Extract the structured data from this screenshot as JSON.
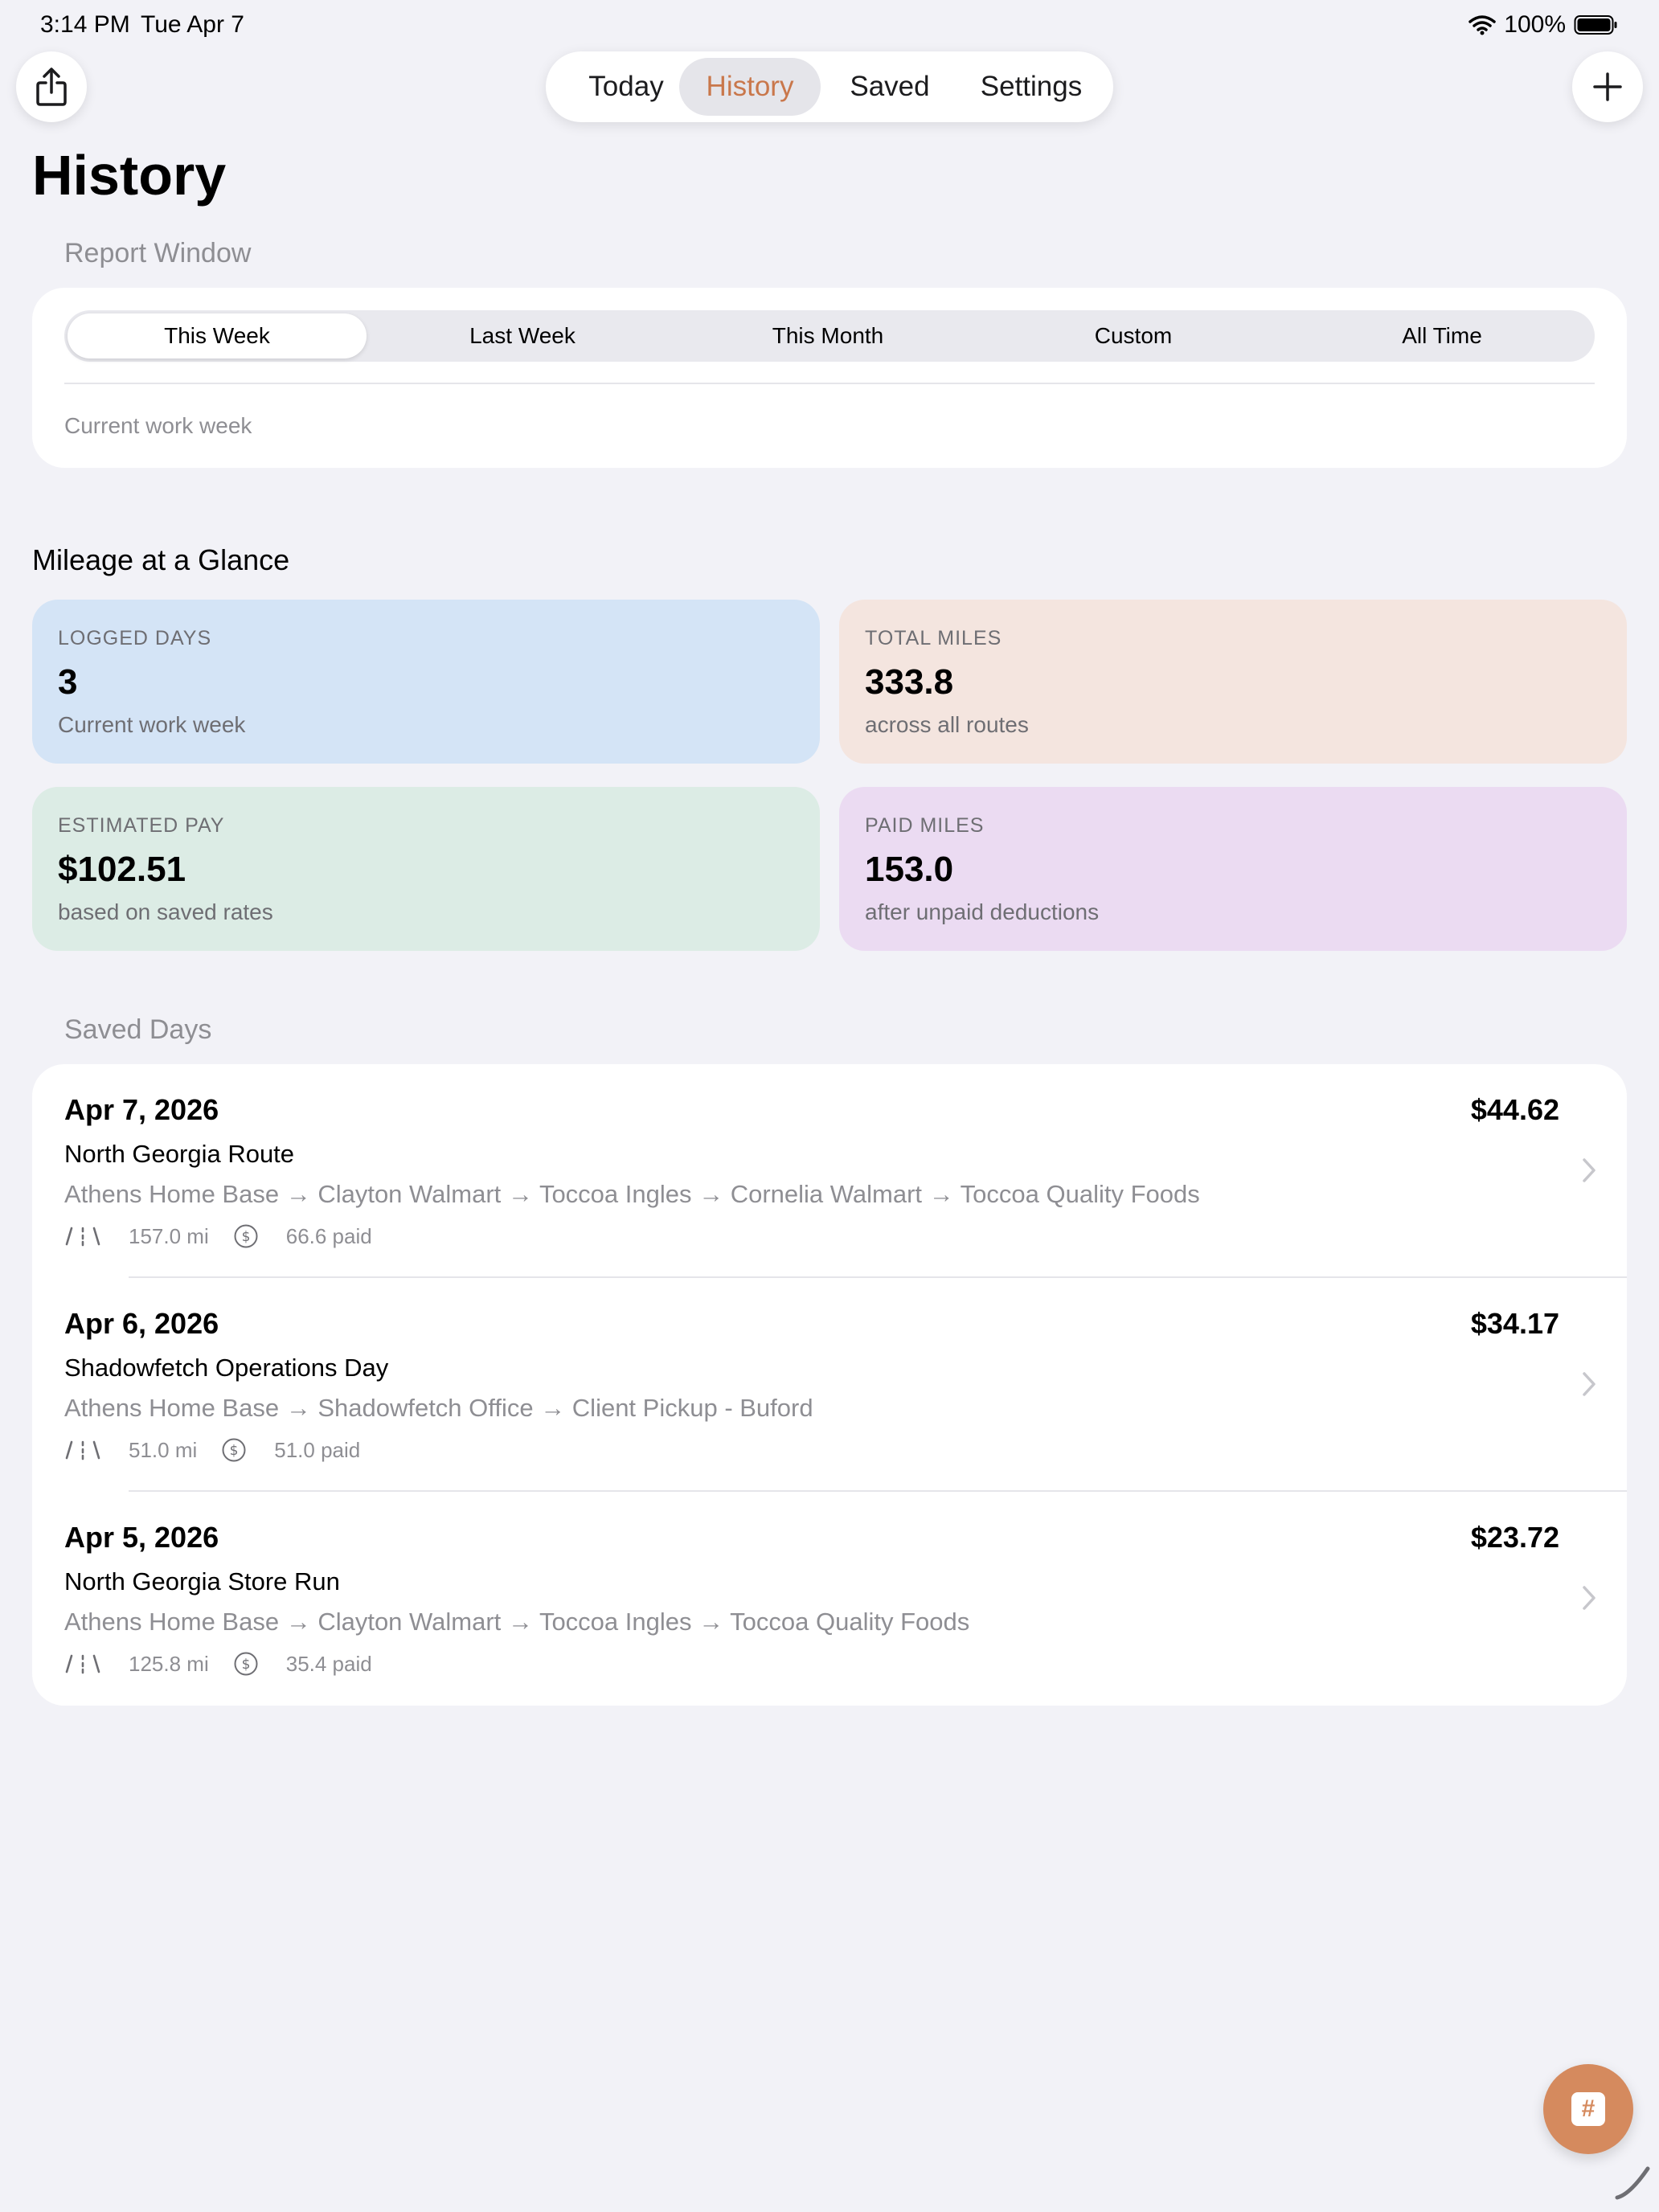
{
  "status_bar": {
    "time": "3:14 PM",
    "date": "Tue Apr 7",
    "battery": "100%"
  },
  "nav": {
    "tabs": [
      {
        "label": "Today",
        "active": false
      },
      {
        "label": "History",
        "active": true
      },
      {
        "label": "Saved",
        "active": false
      },
      {
        "label": "Settings",
        "active": false
      }
    ]
  },
  "page": {
    "title": "History"
  },
  "report_window": {
    "header": "Report Window",
    "options": [
      "This Week",
      "Last Week",
      "This Month",
      "Custom",
      "All Time"
    ],
    "selected": "This Week",
    "caption": "Current work week"
  },
  "glance": {
    "title": "Mileage at a Glance",
    "stats": [
      {
        "label": "LOGGED DAYS",
        "value": "3",
        "sub": "Current work week"
      },
      {
        "label": "TOTAL MILES",
        "value": "333.8",
        "sub": "across all routes"
      },
      {
        "label": "ESTIMATED PAY",
        "value": "$102.51",
        "sub": "based on saved rates"
      },
      {
        "label": "PAID MILES",
        "value": "153.0",
        "sub": "after unpaid deductions"
      }
    ]
  },
  "saved_days": {
    "header": "Saved Days",
    "items": [
      {
        "date": "Apr 7, 2026",
        "pay": "$44.62",
        "name": "North Georgia Route",
        "route": "Athens Home Base → Clayton Walmart → Toccoa Ingles → Cornelia Walmart → Toccoa Quality Foods",
        "miles": "157.0 mi",
        "paid": "66.6 paid"
      },
      {
        "date": "Apr 6, 2026",
        "pay": "$34.17",
        "name": "Shadowfetch Operations Day",
        "route": "Athens Home Base → Shadowfetch Office → Client Pickup - Buford",
        "miles": "51.0 mi",
        "paid": "51.0 paid"
      },
      {
        "date": "Apr 5, 2026",
        "pay": "$23.72",
        "name": "North Georgia Store Run",
        "route": "Athens Home Base → Clayton Walmart → Toccoa Ingles → Toccoa Quality Foods",
        "miles": "125.8 mi",
        "paid": "35.4 paid"
      }
    ]
  },
  "fab": {
    "glyph": "#",
    "color": "#d58a5e"
  },
  "colors": {
    "accent": "#c9774b",
    "background": "#f2f2f7"
  }
}
